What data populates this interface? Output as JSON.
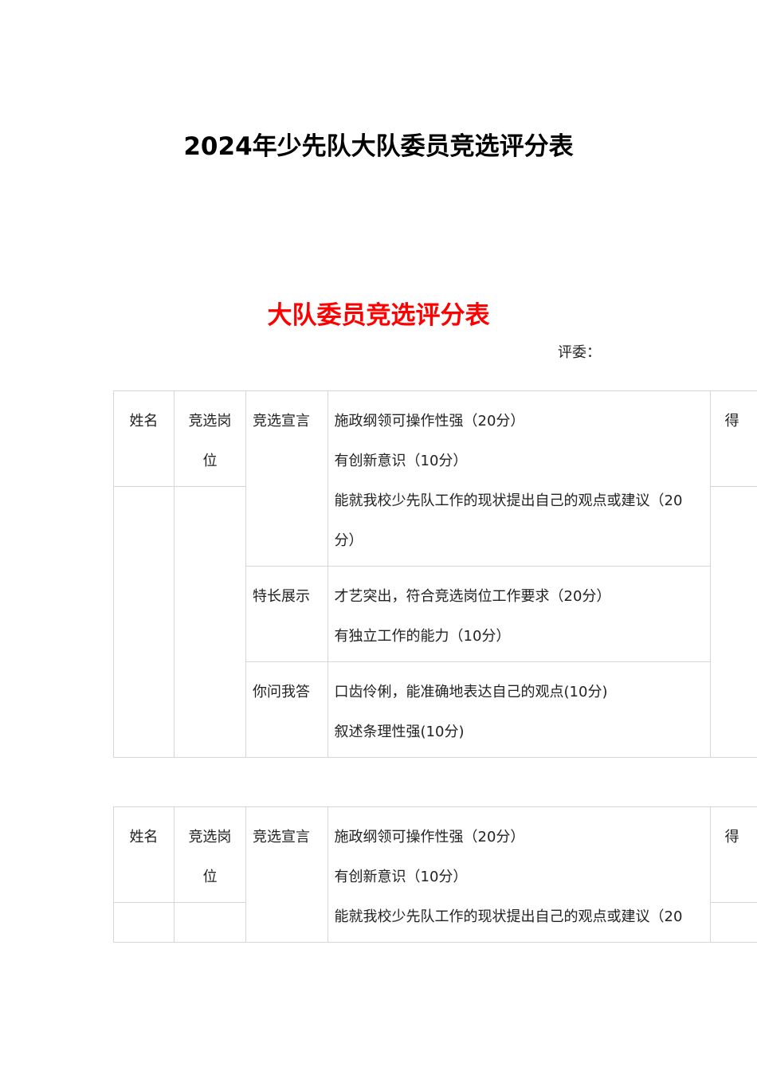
{
  "document": {
    "title": "2024年少先队大队委员竞选评分表",
    "sheet_title": "大队委员竞选评分表",
    "judge_label": "评委："
  },
  "table1": {
    "header": {
      "name": "姓名",
      "position_line1": "竞选岗",
      "position_line2": "位",
      "score_partial": "得"
    },
    "sections": [
      {
        "label": "竞选宣言",
        "criteria": [
          "施政纲领可操作性强（20分）",
          "有创新意识（10分）",
          "能就我校少先队工作的现状提出自己的观点或建议（20",
          "分）"
        ]
      },
      {
        "label": "特长展示",
        "criteria": [
          "才艺突出，符合竞选岗位工作要求（20分）",
          "有独立工作的能力（10分）"
        ]
      },
      {
        "label": "你问我答",
        "criteria": [
          "口齿伶俐，能准确地表达自己的观点(10分)",
          "叙述条理性强(10分)"
        ]
      }
    ]
  },
  "table2": {
    "header": {
      "name": "姓名",
      "position_line1": "竞选岗",
      "position_line2": "位",
      "score_partial": "得"
    },
    "sections": [
      {
        "label": "竞选宣言",
        "criteria": [
          "施政纲领可操作性强（20分）",
          "有创新意识（10分）",
          "能就我校少先队工作的现状提出自己的观点或建议（20"
        ]
      }
    ]
  }
}
